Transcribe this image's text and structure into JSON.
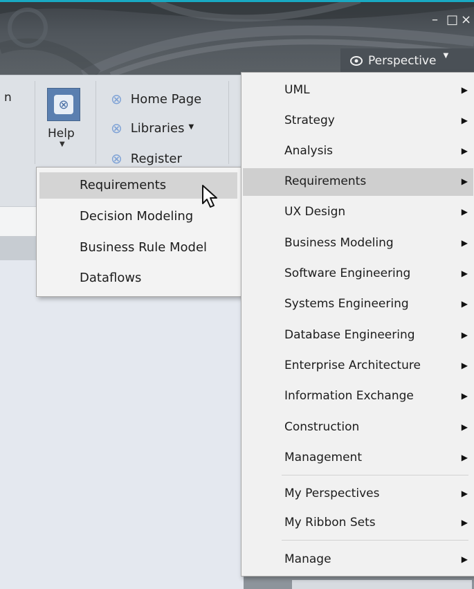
{
  "window": {
    "minimize_glyph": "–",
    "maximize_glyph": "□",
    "close_glyph": "×",
    "accent_color": "#19a9c2"
  },
  "perspective_button": {
    "icon": "eye-icon",
    "label": "Perspective"
  },
  "ribbon": {
    "left_fragment": "n",
    "help_button": {
      "icon": "help-book-icon",
      "label": "Help"
    },
    "links": [
      {
        "icon": "globe-link-icon",
        "label": "Home Page"
      },
      {
        "icon": "globe-link-icon",
        "label": "Libraries"
      },
      {
        "icon": "globe-link-icon",
        "label": "Register"
      }
    ]
  },
  "submenu": {
    "items": [
      {
        "label": "Requirements",
        "highlighted": true
      },
      {
        "label": "Decision Modeling",
        "highlighted": false
      },
      {
        "label": "Business Rule Model",
        "highlighted": false
      },
      {
        "label": "Dataflows",
        "highlighted": false
      }
    ]
  },
  "perspective_menu": {
    "items": [
      {
        "label": "UML",
        "highlighted": false
      },
      {
        "label": "Strategy",
        "highlighted": false
      },
      {
        "label": "Analysis",
        "highlighted": false
      },
      {
        "label": "Requirements",
        "highlighted": true
      },
      {
        "label": "UX Design",
        "highlighted": false
      },
      {
        "label": "Business Modeling",
        "highlighted": false
      },
      {
        "label": "Software Engineering",
        "highlighted": false
      },
      {
        "label": "Systems Engineering",
        "highlighted": false
      },
      {
        "label": "Database Engineering",
        "highlighted": false
      },
      {
        "label": "Enterprise Architecture",
        "highlighted": false
      },
      {
        "label": "Information Exchange",
        "highlighted": false
      },
      {
        "label": "Construction",
        "highlighted": false
      },
      {
        "label": "Management",
        "highlighted": false
      },
      {
        "label": "My Perspectives",
        "highlighted": false
      },
      {
        "label": "My Ribbon Sets",
        "highlighted": false
      },
      {
        "label": "Manage",
        "highlighted": false
      }
    ]
  }
}
